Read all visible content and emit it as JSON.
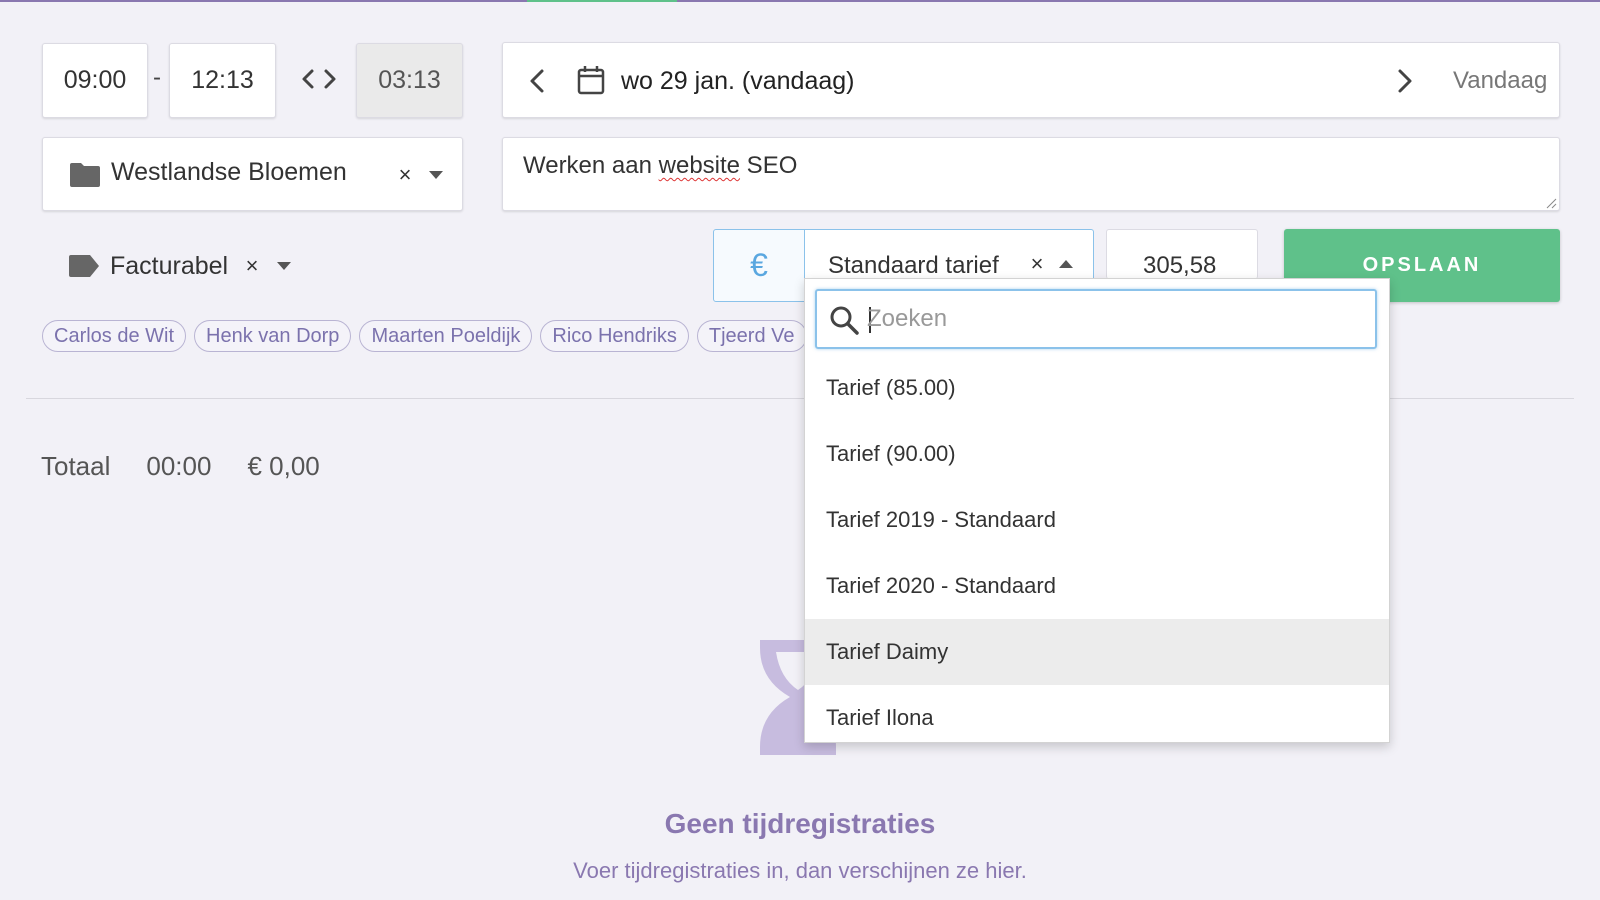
{
  "time": {
    "start": "09:00",
    "separator": "-",
    "end": "12:13",
    "duration": "03:13"
  },
  "date": {
    "label": "wo 29 jan. (vandaag)",
    "today_button": "Vandaag"
  },
  "project": {
    "name": "Westlandse Bloemen",
    "clear": "×"
  },
  "description": {
    "before": "Werken aan ",
    "misspelled": "website",
    "after": " SEO"
  },
  "tag": {
    "name": "Facturabel",
    "clear": "×"
  },
  "rate": {
    "currency_symbol": "€",
    "selected": "Standaard tarief",
    "clear": "×",
    "amount": "305,58"
  },
  "save_label": "OPSLAAN",
  "users": [
    "Carlos de Wit",
    "Henk van Dorp",
    "Maarten Poeldijk",
    "Rico Hendriks",
    "Tjeerd Ve"
  ],
  "total": {
    "label": "Totaal",
    "time": "00:00",
    "amount": "€ 0,00"
  },
  "dropdown": {
    "search_placeholder": "Zoeken",
    "options": [
      "Tarief (85.00)",
      "Tarief (90.00)",
      "Tarief 2019 - Standaard",
      "Tarief 2020 - Standaard",
      "Tarief Daimy",
      "Tarief Ilona"
    ],
    "highlighted_index": 4
  },
  "empty_state": {
    "title": "Geen tijdregistraties",
    "subtitle": "Voer tijdregistraties in, dan verschijnen ze hier."
  },
  "colors": {
    "accent": "#8a78b0",
    "save": "#5fc18a",
    "focus": "#8bc2ea",
    "euro": "#5aa7e0"
  },
  "icons": [
    "chevron-left-icon",
    "calendar-icon",
    "chevron-right-icon",
    "swap-icon",
    "folder-icon",
    "tag-icon",
    "search-icon",
    "hourglass-icon"
  ]
}
